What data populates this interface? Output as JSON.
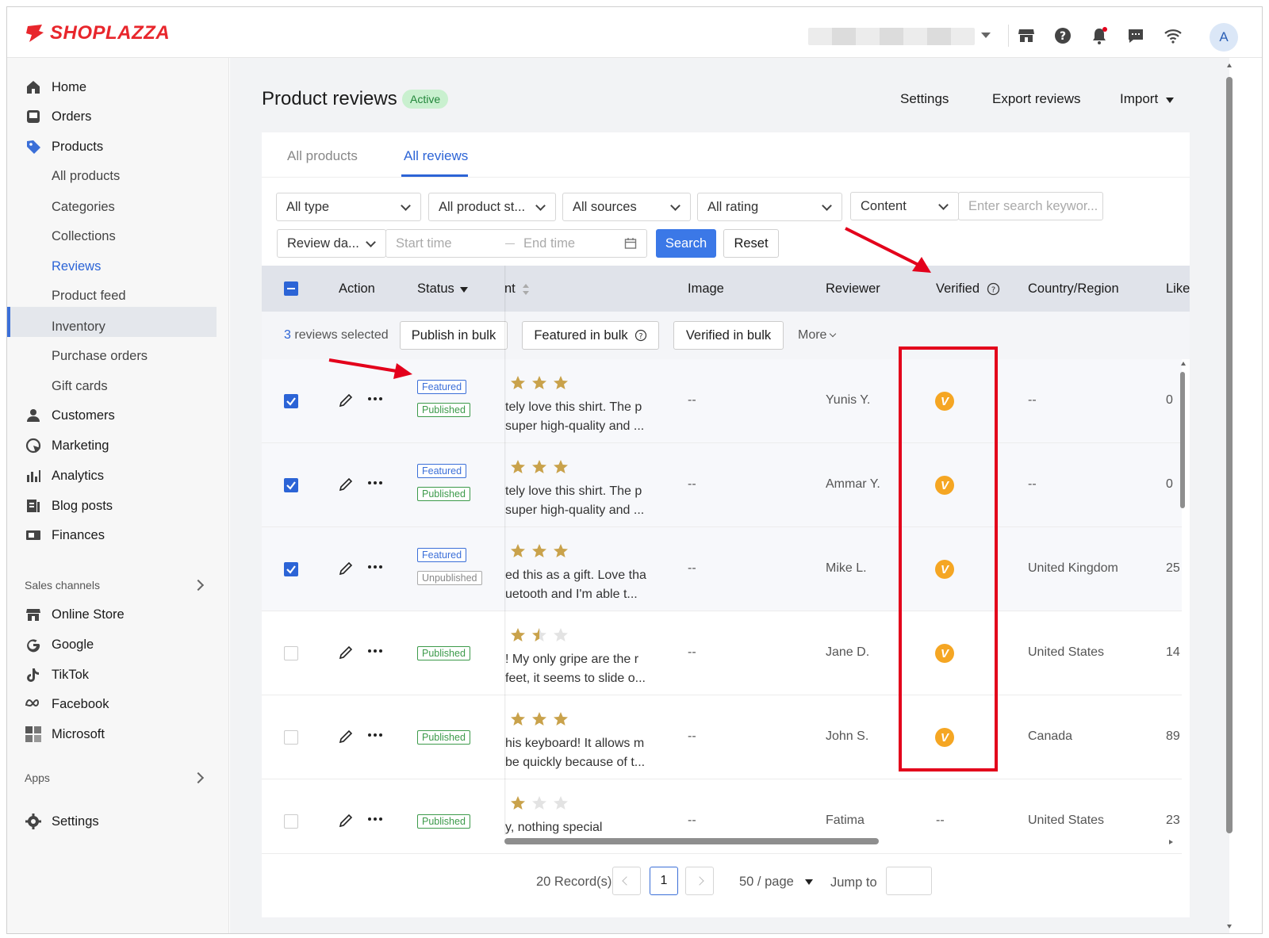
{
  "brand": {
    "name": "SHOPLAZZA",
    "color": "#e8262c"
  },
  "topbar": {
    "avatar_initial": "A",
    "icons": [
      "store-icon",
      "help-icon",
      "bell-icon",
      "chat-icon",
      "wifi-icon"
    ]
  },
  "sidebar": {
    "items": [
      {
        "label": "Home",
        "icon": "home-icon"
      },
      {
        "label": "Orders",
        "icon": "orders-icon"
      },
      {
        "label": "Products",
        "icon": "tag-icon"
      }
    ],
    "product_sub": [
      "All products",
      "Categories",
      "Collections",
      "Reviews",
      "Product feed",
      "Inventory",
      "Purchase orders",
      "Gift cards"
    ],
    "items2": [
      {
        "label": "Customers",
        "icon": "person-icon"
      },
      {
        "label": "Marketing",
        "icon": "marketing-icon"
      },
      {
        "label": "Analytics",
        "icon": "chart-icon"
      },
      {
        "label": "Blog posts",
        "icon": "blog-icon"
      },
      {
        "label": "Finances",
        "icon": "finance-icon"
      }
    ],
    "sales_channels_title": "Sales channels",
    "channels": [
      {
        "label": "Online Store",
        "icon": "store-icon"
      },
      {
        "label": "Google",
        "icon": "google-icon"
      },
      {
        "label": "TikTok",
        "icon": "tiktok-icon"
      },
      {
        "label": "Facebook",
        "icon": "meta-icon"
      },
      {
        "label": "Microsoft",
        "icon": "microsoft-icon"
      }
    ],
    "apps_title": "Apps",
    "settings_label": "Settings"
  },
  "header": {
    "title": "Product reviews",
    "status": "Active",
    "settings": "Settings",
    "export": "Export reviews",
    "import": "Import"
  },
  "tabs": [
    {
      "label": "All products"
    },
    {
      "label": "All reviews"
    }
  ],
  "filters": {
    "type": "All type",
    "product_status": "All product st...",
    "sources": "All sources",
    "rating": "All rating",
    "content": "Content",
    "search_placeholder": "Enter search keywor...",
    "review_date": "Review da...",
    "start_placeholder": "Start time",
    "end_placeholder": "End time",
    "search_btn": "Search",
    "reset_btn": "Reset"
  },
  "table": {
    "columns": {
      "action": "Action",
      "status": "Status",
      "content_partial": "nt",
      "image": "Image",
      "reviewer": "Reviewer",
      "verified": "Verified",
      "country": "Country/Region",
      "likes": "Like"
    },
    "bulk": {
      "selected_count": "3",
      "selected_text": "reviews selected",
      "publish": "Publish in bulk",
      "featured": "Featured in bulk",
      "verified": "Verified in bulk",
      "more": "More"
    },
    "rows": [
      {
        "selected": true,
        "featured": "Featured",
        "pub": "Published",
        "pub_state": "published",
        "rating": 5,
        "line1": "tely love this shirt. The p",
        "line2": "super high-quality and ...",
        "image": "--",
        "reviewer": "Yunis Y.",
        "verified": "V",
        "country": "--",
        "likes": "0"
      },
      {
        "selected": true,
        "featured": "Featured",
        "pub": "Published",
        "pub_state": "published",
        "rating": 5,
        "line1": "tely love this shirt. The p",
        "line2": "super high-quality and ...",
        "image": "--",
        "reviewer": "Ammar Y.",
        "verified": "V",
        "country": "--",
        "likes": "0"
      },
      {
        "selected": true,
        "featured": "Featured",
        "pub": "Unpublished",
        "pub_state": "unpublished",
        "rating": 5,
        "line1": "ed this as a gift. Love tha",
        "line2": "uetooth and I'm able t...",
        "image": "--",
        "reviewer": "Mike L.",
        "verified": "V",
        "country": "United Kingdom",
        "likes": "25"
      },
      {
        "selected": false,
        "featured": "",
        "pub": "Published",
        "pub_state": "published",
        "rating": 1.5,
        "line1": "! My only gripe are the r",
        "line2": "feet, it seems to slide o...",
        "image": "--",
        "reviewer": "Jane D.",
        "verified": "V",
        "country": "United States",
        "likes": "14"
      },
      {
        "selected": false,
        "featured": "",
        "pub": "Published",
        "pub_state": "published",
        "rating": 5,
        "line1": "his keyboard! It allows m",
        "line2": "be quickly because of t...",
        "image": "--",
        "reviewer": "John S.",
        "verified": "V",
        "country": "Canada",
        "likes": "89"
      },
      {
        "selected": false,
        "featured": "",
        "pub": "Published",
        "pub_state": "published",
        "rating": 1,
        "line1": "y, nothing special",
        "line2": "",
        "image": "--",
        "reviewer": "Fatima",
        "verified": "--",
        "country": "United States",
        "likes": "23"
      }
    ]
  },
  "pagination": {
    "records": "20 Record(s)",
    "current_page": "1",
    "per_page": "50 / page",
    "jump_to": "Jump to"
  },
  "colors": {
    "accent": "#2c64d6",
    "star": "#c9a24b",
    "verified": "#f5a623",
    "annotation": "#e3001b"
  }
}
